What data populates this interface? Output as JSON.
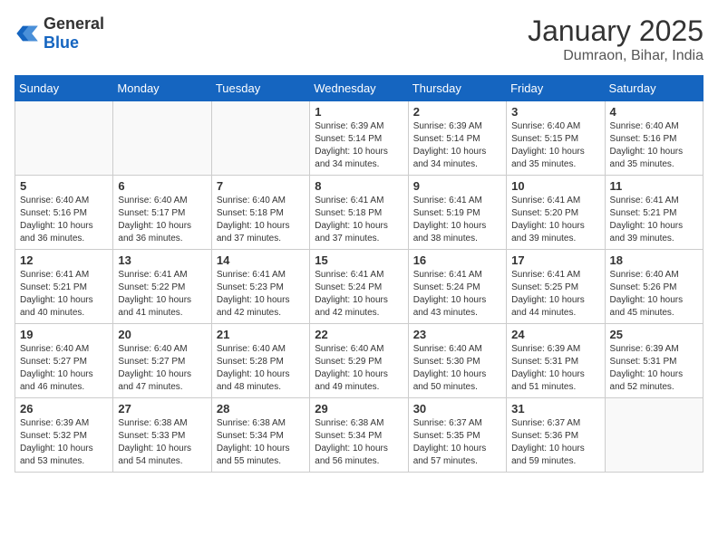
{
  "header": {
    "logo_general": "General",
    "logo_blue": "Blue",
    "month_year": "January 2025",
    "location": "Dumraon, Bihar, India"
  },
  "days_of_week": [
    "Sunday",
    "Monday",
    "Tuesday",
    "Wednesday",
    "Thursday",
    "Friday",
    "Saturday"
  ],
  "weeks": [
    [
      {
        "day": "",
        "info": ""
      },
      {
        "day": "",
        "info": ""
      },
      {
        "day": "",
        "info": ""
      },
      {
        "day": "1",
        "info": "Sunrise: 6:39 AM\nSunset: 5:14 PM\nDaylight: 10 hours\nand 34 minutes."
      },
      {
        "day": "2",
        "info": "Sunrise: 6:39 AM\nSunset: 5:14 PM\nDaylight: 10 hours\nand 34 minutes."
      },
      {
        "day": "3",
        "info": "Sunrise: 6:40 AM\nSunset: 5:15 PM\nDaylight: 10 hours\nand 35 minutes."
      },
      {
        "day": "4",
        "info": "Sunrise: 6:40 AM\nSunset: 5:16 PM\nDaylight: 10 hours\nand 35 minutes."
      }
    ],
    [
      {
        "day": "5",
        "info": "Sunrise: 6:40 AM\nSunset: 5:16 PM\nDaylight: 10 hours\nand 36 minutes."
      },
      {
        "day": "6",
        "info": "Sunrise: 6:40 AM\nSunset: 5:17 PM\nDaylight: 10 hours\nand 36 minutes."
      },
      {
        "day": "7",
        "info": "Sunrise: 6:40 AM\nSunset: 5:18 PM\nDaylight: 10 hours\nand 37 minutes."
      },
      {
        "day": "8",
        "info": "Sunrise: 6:41 AM\nSunset: 5:18 PM\nDaylight: 10 hours\nand 37 minutes."
      },
      {
        "day": "9",
        "info": "Sunrise: 6:41 AM\nSunset: 5:19 PM\nDaylight: 10 hours\nand 38 minutes."
      },
      {
        "day": "10",
        "info": "Sunrise: 6:41 AM\nSunset: 5:20 PM\nDaylight: 10 hours\nand 39 minutes."
      },
      {
        "day": "11",
        "info": "Sunrise: 6:41 AM\nSunset: 5:21 PM\nDaylight: 10 hours\nand 39 minutes."
      }
    ],
    [
      {
        "day": "12",
        "info": "Sunrise: 6:41 AM\nSunset: 5:21 PM\nDaylight: 10 hours\nand 40 minutes."
      },
      {
        "day": "13",
        "info": "Sunrise: 6:41 AM\nSunset: 5:22 PM\nDaylight: 10 hours\nand 41 minutes."
      },
      {
        "day": "14",
        "info": "Sunrise: 6:41 AM\nSunset: 5:23 PM\nDaylight: 10 hours\nand 42 minutes."
      },
      {
        "day": "15",
        "info": "Sunrise: 6:41 AM\nSunset: 5:24 PM\nDaylight: 10 hours\nand 42 minutes."
      },
      {
        "day": "16",
        "info": "Sunrise: 6:41 AM\nSunset: 5:24 PM\nDaylight: 10 hours\nand 43 minutes."
      },
      {
        "day": "17",
        "info": "Sunrise: 6:41 AM\nSunset: 5:25 PM\nDaylight: 10 hours\nand 44 minutes."
      },
      {
        "day": "18",
        "info": "Sunrise: 6:40 AM\nSunset: 5:26 PM\nDaylight: 10 hours\nand 45 minutes."
      }
    ],
    [
      {
        "day": "19",
        "info": "Sunrise: 6:40 AM\nSunset: 5:27 PM\nDaylight: 10 hours\nand 46 minutes."
      },
      {
        "day": "20",
        "info": "Sunrise: 6:40 AM\nSunset: 5:27 PM\nDaylight: 10 hours\nand 47 minutes."
      },
      {
        "day": "21",
        "info": "Sunrise: 6:40 AM\nSunset: 5:28 PM\nDaylight: 10 hours\nand 48 minutes."
      },
      {
        "day": "22",
        "info": "Sunrise: 6:40 AM\nSunset: 5:29 PM\nDaylight: 10 hours\nand 49 minutes."
      },
      {
        "day": "23",
        "info": "Sunrise: 6:40 AM\nSunset: 5:30 PM\nDaylight: 10 hours\nand 50 minutes."
      },
      {
        "day": "24",
        "info": "Sunrise: 6:39 AM\nSunset: 5:31 PM\nDaylight: 10 hours\nand 51 minutes."
      },
      {
        "day": "25",
        "info": "Sunrise: 6:39 AM\nSunset: 5:31 PM\nDaylight: 10 hours\nand 52 minutes."
      }
    ],
    [
      {
        "day": "26",
        "info": "Sunrise: 6:39 AM\nSunset: 5:32 PM\nDaylight: 10 hours\nand 53 minutes."
      },
      {
        "day": "27",
        "info": "Sunrise: 6:38 AM\nSunset: 5:33 PM\nDaylight: 10 hours\nand 54 minutes."
      },
      {
        "day": "28",
        "info": "Sunrise: 6:38 AM\nSunset: 5:34 PM\nDaylight: 10 hours\nand 55 minutes."
      },
      {
        "day": "29",
        "info": "Sunrise: 6:38 AM\nSunset: 5:34 PM\nDaylight: 10 hours\nand 56 minutes."
      },
      {
        "day": "30",
        "info": "Sunrise: 6:37 AM\nSunset: 5:35 PM\nDaylight: 10 hours\nand 57 minutes."
      },
      {
        "day": "31",
        "info": "Sunrise: 6:37 AM\nSunset: 5:36 PM\nDaylight: 10 hours\nand 59 minutes."
      },
      {
        "day": "",
        "info": ""
      }
    ]
  ]
}
